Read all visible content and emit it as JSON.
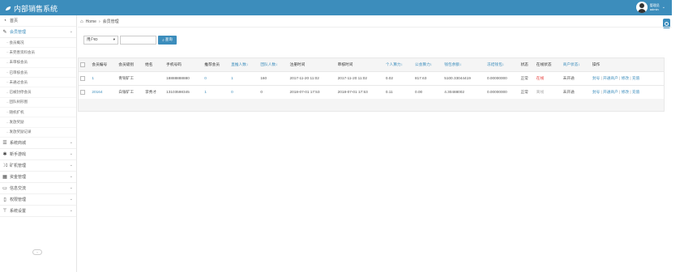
{
  "header": {
    "app_title": "内部销售系统",
    "user_role": "管理员",
    "user_name": "admin"
  },
  "sidebar": {
    "items_top": [
      {
        "label": "首页",
        "icon": "dashboard-icon"
      },
      {
        "label": "会员管理",
        "icon": "edit-icon"
      }
    ],
    "sub_items": [
      "会员概况",
      "未完善资料会员",
      "未审核会员",
      "已审核会员",
      "未通过会员",
      "已被封停会员",
      "团队树形图",
      "随机扩机",
      "发放奖励",
      "发放奖励记录"
    ],
    "items_bottom": [
      {
        "label": "系统商城",
        "icon": "list-icon"
      },
      {
        "label": "新手游戏",
        "icon": "star-icon"
      },
      {
        "label": "矿机管理",
        "icon": "shuffle-icon"
      },
      {
        "label": "资金管理",
        "icon": "calendar-icon"
      },
      {
        "label": "信息交流",
        "icon": "card-icon"
      },
      {
        "label": "权限管理",
        "icon": "file-icon"
      },
      {
        "label": "系统设置",
        "icon": "tool-icon"
      }
    ]
  },
  "breadcrumb": {
    "home": "Home",
    "current": "会员管理"
  },
  "filter": {
    "select_value": "用户ID",
    "search_value": "",
    "query_label": "查询"
  },
  "table": {
    "columns": [
      {
        "label": "会员编号",
        "sort": false
      },
      {
        "label": "会员级别",
        "sort": false
      },
      {
        "label": "姓名",
        "sort": false
      },
      {
        "label": "手机号码",
        "sort": false
      },
      {
        "label": "推荐会员",
        "sort": false
      },
      {
        "label": "直推人数↕",
        "sort": true
      },
      {
        "label": "团队人数↕",
        "sort": true
      },
      {
        "label": "注册时间",
        "sort": false
      },
      {
        "label": "审核时间",
        "sort": false
      },
      {
        "label": "个人算力↕",
        "sort": true
      },
      {
        "label": "公会算力↕",
        "sort": true
      },
      {
        "label": "钱包余额↕",
        "sort": true
      },
      {
        "label": "冻结钱包↕",
        "sort": true
      },
      {
        "label": "状态",
        "sort": false
      },
      {
        "label": "在线状态",
        "sort": false
      },
      {
        "label": "商户状态↕",
        "sort": true
      },
      {
        "label": "操作",
        "sort": false
      }
    ],
    "rows": [
      {
        "id": "1",
        "level": "青铜矿工",
        "name": "",
        "phone": "18888888880",
        "referrer": "0",
        "direct": "1",
        "team": "160",
        "reg_time": "2017-11-20 11:02",
        "audit_time": "2017-11-20 11:02",
        "personal": "0.02",
        "guild": "817.63",
        "wallet": "5100.33044419",
        "frozen": "0.00000000",
        "status": "正常",
        "online": "在线",
        "merchant": "未开通",
        "actions": [
          "封号",
          "开通商户",
          "修改",
          "充值"
        ]
      },
      {
        "id": "20164",
        "level": "白银矿工",
        "name": "李秀才",
        "phone": "13103598345",
        "referrer": "1",
        "direct": "0",
        "team": "0",
        "reg_time": "2018-07-01 17:53",
        "audit_time": "2018-07-01 17:53",
        "personal": "0.11",
        "guild": "0.00",
        "wallet": "4.30488002",
        "frozen": "0.00000000",
        "status": "正常",
        "online": "离线",
        "merchant": "未开通",
        "actions": [
          "封号",
          "开通商户",
          "修改",
          "充值"
        ]
      }
    ]
  },
  "colors": {
    "primary": "#3c8dbc",
    "online": "#e53935"
  }
}
